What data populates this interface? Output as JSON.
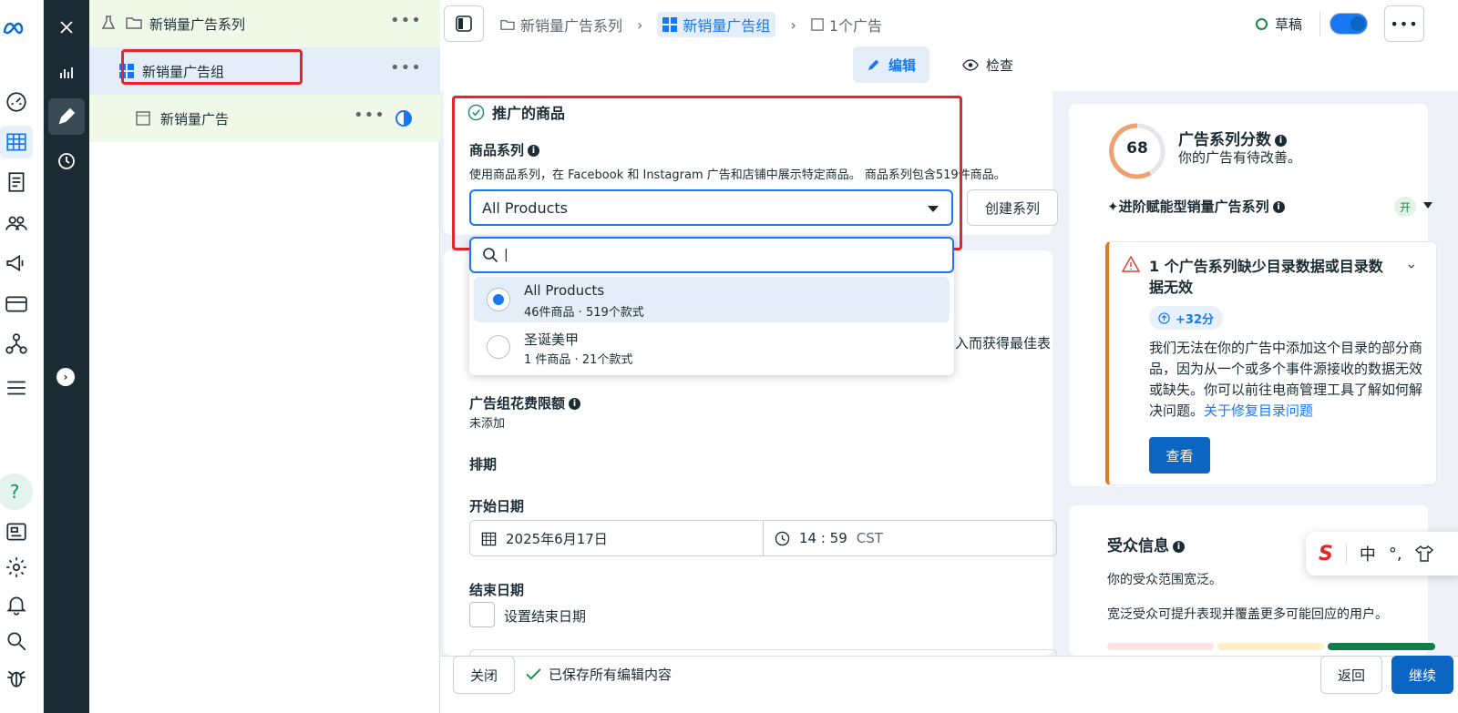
{
  "tree": {
    "campaign": "新销量广告系列",
    "adset": "新销量广告组",
    "ad": "新销量广告"
  },
  "breadcrumb": {
    "campaign": "新销量广告系列",
    "adset": "新销量广告组",
    "ad": "1个广告"
  },
  "status": {
    "label": "草稿",
    "color": "#1b8a3e"
  },
  "modes": {
    "edit": "编辑",
    "review": "检查"
  },
  "product_section": {
    "title": "推广的商品",
    "set_label": "商品系列",
    "description": "使用商品系列，在 Facebook 和 Instagram 广告和店铺中展示特定商品。 商品系列包含519件商品。",
    "selected": "All Products",
    "create_button": "创建系列",
    "search_placeholder": "|",
    "options": [
      {
        "name": "All Products",
        "meta": "46件商品 · 519个款式",
        "selected": true
      },
      {
        "name": "圣诞美甲",
        "meta": "1 件商品 · 21个款式",
        "selected": false
      }
    ]
  },
  "hidden_snippet": "入而获得最佳表",
  "spend_limit": {
    "label": "广告组花费限额",
    "value": "未添加"
  },
  "schedule": {
    "title": "排期",
    "start_label": "开始日期",
    "start_date": "2025年6月17日",
    "start_time": "14 : 59",
    "timezone": "CST",
    "end_label": "结束日期",
    "end_checkbox": "设置结束日期"
  },
  "score": {
    "value": "68",
    "title": "广告系列分数",
    "subtitle": "你的广告有待改善。",
    "advantage_label": "✦进阶赋能型销量广告系列",
    "advantage_state": "开"
  },
  "alert": {
    "title": "1 个广告系列缺少目录数据或目录数据无效",
    "badge": "+32分",
    "body": "我们无法在你的广告中添加这个目录的部分商品，因为从一个或多个事件源接收的数据无效或缺失。你可以前往电商管理工具了解如何解决问题。",
    "link": "关于修复目录问题",
    "button": "查看",
    "accent": "#e07b1e"
  },
  "audience": {
    "title": "受众信息",
    "line1": "你的受众范围宽泛。",
    "line2": "宽泛受众可提升表现并覆盖更多可能回应的用户。"
  },
  "ime": {
    "cn": "中",
    "punct": "°,"
  },
  "footer": {
    "close": "关闭",
    "saved": "已保存所有编辑内容",
    "back": "返回",
    "continue": "继续"
  },
  "colors": {
    "primary": "#1877f2",
    "button_blue": "#0a66c2",
    "dark_rail": "#1c2b33",
    "highlight": "#e8252a"
  }
}
